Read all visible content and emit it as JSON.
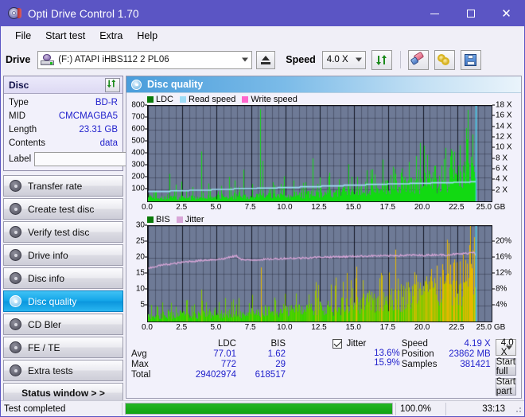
{
  "window": {
    "title": "Opti Drive Control 1.70",
    "app_icon": "disc-icon",
    "minimize": "–",
    "maximize": "□",
    "close": "✕"
  },
  "menu": [
    "File",
    "Start test",
    "Extra",
    "Help"
  ],
  "toolbar": {
    "drive_label": "Drive",
    "drive_value": "(F:)  ATAPI iHBS112  2 PL06",
    "eject_icon": "eject-icon",
    "speed_label": "Speed",
    "speed_value": "4.0 X",
    "refresh_icon": "refresh-icon",
    "eraser_icon": "eraser-icon",
    "bitsetting_icon": "bitsetting-icon",
    "save_icon": "save-icon"
  },
  "sidebar": {
    "disc_panel": {
      "title": "Disc",
      "refresh_icon": "refresh-icon",
      "rows": [
        {
          "key": "Type",
          "value": "BD-R"
        },
        {
          "key": "MID",
          "value": "CMCMAGBA5"
        },
        {
          "key": "Length",
          "value": "23.31 GB"
        },
        {
          "key": "Contents",
          "value": "data"
        }
      ],
      "label_key": "Label",
      "label_value": "",
      "label_placeholder": "",
      "label_button_icon": "disc-icon"
    },
    "items": [
      {
        "label": "Transfer rate",
        "selected": false
      },
      {
        "label": "Create test disc",
        "selected": false
      },
      {
        "label": "Verify test disc",
        "selected": false
      },
      {
        "label": "Drive info",
        "selected": false
      },
      {
        "label": "Disc info",
        "selected": false
      },
      {
        "label": "Disc quality",
        "selected": true
      },
      {
        "label": "CD Bler",
        "selected": false
      },
      {
        "label": "FE / TE",
        "selected": false
      },
      {
        "label": "Extra tests",
        "selected": false
      }
    ],
    "status_window_button": "Status window > >"
  },
  "main": {
    "header_title": "Disc quality",
    "header_icon": "disc-icon"
  },
  "stats": {
    "col_headers": [
      "LDC",
      "BIS"
    ],
    "row_labels": [
      "Avg",
      "Max",
      "Total"
    ],
    "ldc": {
      "avg": "77.01",
      "max": "772",
      "total": "29402974"
    },
    "bis": {
      "avg": "1.62",
      "max": "29",
      "total": "618517"
    },
    "jitter": {
      "label": "Jitter",
      "checked": true,
      "avg": "13.6%",
      "max": "15.9%"
    },
    "speed_label": "Speed",
    "speed_value": "4.19 X",
    "position_label": "Position",
    "position_value": "23862 MB",
    "samples_label": "Samples",
    "samples_value": "381421",
    "speed_select": "4.0 X",
    "start_full_button": "Start full",
    "start_part_button": "Start part"
  },
  "statusbar": {
    "message": "Test completed",
    "percent_text": "100.0%",
    "percent_value": 100,
    "elapsed": "33:13"
  },
  "colors": {
    "titlebar": "#5b55c4",
    "ldc_green": "#12d912",
    "read_speed": "#9fdcf5",
    "write_speed": "#ff66cc",
    "jitter_pink": "#d8a6d8",
    "plot_bg": "#6e7a96",
    "accent_selected": "#13a5e8",
    "value_blue": "#2222cc",
    "progress_green": "#12a312"
  },
  "chart_data": [
    {
      "id": "ldc-chart",
      "type": "area",
      "title": "",
      "xlabel": "GB",
      "ylabel": "",
      "xlim": [
        0,
        25
      ],
      "ylim": [
        0,
        800
      ],
      "xticks": [
        "0.0",
        "2.5",
        "5.0",
        "7.5",
        "10.0",
        "12.5",
        "15.0",
        "17.5",
        "20.0",
        "22.5",
        "25.0"
      ],
      "xtick_values": [
        0,
        2.5,
        5,
        7.5,
        10,
        12.5,
        15,
        17.5,
        20,
        22.5,
        25
      ],
      "x_unit_label": "GB",
      "yticks": [
        100,
        200,
        300,
        400,
        500,
        600,
        700,
        800
      ],
      "y2label": "Speed",
      "y2lim": [
        0,
        18
      ],
      "y2ticks": [
        "2 X",
        "4 X",
        "6 X",
        "8 X",
        "10 X",
        "12 X",
        "14 X",
        "16 X",
        "18 X"
      ],
      "y2tick_values": [
        2,
        4,
        6,
        8,
        10,
        12,
        14,
        16,
        18
      ],
      "grid": true,
      "legend": [
        {
          "name": "LDC",
          "color": "#0a7a0a"
        },
        {
          "name": "Read speed",
          "color": "#9fdcf5"
        },
        {
          "name": "Write speed",
          "color": "#ff66cc"
        }
      ],
      "legend_position": "top-left",
      "data_extent_x": [
        0,
        23.86
      ],
      "series": [
        {
          "name": "LDC",
          "kind": "impulse-area",
          "color": "#12d912",
          "baseline_profile": [
            {
              "x": 0.0,
              "y": 28
            },
            {
              "x": 1.0,
              "y": 30
            },
            {
              "x": 2.0,
              "y": 32
            },
            {
              "x": 3.0,
              "y": 34
            },
            {
              "x": 4.0,
              "y": 36
            },
            {
              "x": 5.0,
              "y": 38
            },
            {
              "x": 6.0,
              "y": 40
            },
            {
              "x": 7.0,
              "y": 42
            },
            {
              "x": 8.0,
              "y": 45
            },
            {
              "x": 9.0,
              "y": 48
            },
            {
              "x": 10.0,
              "y": 52
            },
            {
              "x": 11.0,
              "y": 58
            },
            {
              "x": 12.0,
              "y": 64
            },
            {
              "x": 13.0,
              "y": 72
            },
            {
              "x": 14.0,
              "y": 82
            },
            {
              "x": 15.0,
              "y": 92
            },
            {
              "x": 16.0,
              "y": 104
            },
            {
              "x": 17.0,
              "y": 118
            },
            {
              "x": 18.0,
              "y": 134
            },
            {
              "x": 19.0,
              "y": 150
            },
            {
              "x": 20.0,
              "y": 168
            },
            {
              "x": 21.0,
              "y": 186
            },
            {
              "x": 22.0,
              "y": 210
            },
            {
              "x": 23.0,
              "y": 240
            },
            {
              "x": 23.5,
              "y": 270
            },
            {
              "x": 23.86,
              "y": 300
            }
          ],
          "spikes": [
            {
              "x": 1.55,
              "y": 230
            },
            {
              "x": 2.05,
              "y": 140
            },
            {
              "x": 2.45,
              "y": 165
            },
            {
              "x": 3.25,
              "y": 120
            },
            {
              "x": 3.9,
              "y": 418
            },
            {
              "x": 4.4,
              "y": 150
            },
            {
              "x": 5.3,
              "y": 130
            },
            {
              "x": 5.9,
              "y": 205
            },
            {
              "x": 6.3,
              "y": 175
            },
            {
              "x": 6.95,
              "y": 265
            },
            {
              "x": 7.6,
              "y": 145
            },
            {
              "x": 8.15,
              "y": 772
            },
            {
              "x": 8.35,
              "y": 340
            },
            {
              "x": 9.1,
              "y": 160
            },
            {
              "x": 9.9,
              "y": 210
            },
            {
              "x": 10.6,
              "y": 175
            },
            {
              "x": 11.3,
              "y": 155
            },
            {
              "x": 12.0,
              "y": 360
            },
            {
              "x": 12.5,
              "y": 200
            },
            {
              "x": 13.2,
              "y": 240
            },
            {
              "x": 13.9,
              "y": 185
            },
            {
              "x": 14.6,
              "y": 310
            },
            {
              "x": 15.2,
              "y": 205
            },
            {
              "x": 15.9,
              "y": 260
            },
            {
              "x": 16.5,
              "y": 225
            },
            {
              "x": 17.1,
              "y": 350
            },
            {
              "x": 17.8,
              "y": 290
            },
            {
              "x": 18.4,
              "y": 240
            },
            {
              "x": 19.0,
              "y": 330
            },
            {
              "x": 19.7,
              "y": 265
            },
            {
              "x": 20.3,
              "y": 390
            },
            {
              "x": 20.9,
              "y": 300
            },
            {
              "x": 21.5,
              "y": 355
            },
            {
              "x": 22.1,
              "y": 420
            },
            {
              "x": 22.7,
              "y": 470
            },
            {
              "x": 23.2,
              "y": 520
            },
            {
              "x": 23.6,
              "y": 560
            }
          ]
        },
        {
          "name": "Read speed",
          "kind": "step-line",
          "color": "#9fdcf5",
          "axis": "right",
          "points": [
            {
              "x": 0.0,
              "y": 1.85
            },
            {
              "x": 1.6,
              "y": 2.0
            },
            {
              "x": 3.0,
              "y": 2.1
            },
            {
              "x": 4.6,
              "y": 2.25
            },
            {
              "x": 6.2,
              "y": 2.4
            },
            {
              "x": 7.9,
              "y": 2.5
            },
            {
              "x": 9.4,
              "y": 2.6
            },
            {
              "x": 11.0,
              "y": 2.75
            },
            {
              "x": 12.6,
              "y": 2.9
            },
            {
              "x": 14.2,
              "y": 3.05
            },
            {
              "x": 15.8,
              "y": 3.2
            },
            {
              "x": 17.4,
              "y": 3.3
            },
            {
              "x": 19.0,
              "y": 3.4
            },
            {
              "x": 20.6,
              "y": 3.5
            },
            {
              "x": 22.2,
              "y": 3.6
            },
            {
              "x": 23.4,
              "y": 3.7
            },
            {
              "x": 23.86,
              "y": 3.75
            }
          ]
        },
        {
          "name": "end-marker",
          "kind": "vline",
          "color": "#45d8f5",
          "x": 23.86
        }
      ]
    },
    {
      "id": "bis-jitter-chart",
      "type": "area",
      "title": "",
      "xlabel": "GB",
      "xlim": [
        0,
        25
      ],
      "ylim": [
        0,
        30
      ],
      "xticks": [
        "0.0",
        "2.5",
        "5.0",
        "7.5",
        "10.0",
        "12.5",
        "15.0",
        "17.5",
        "20.0",
        "22.5",
        "25.0"
      ],
      "xtick_values": [
        0,
        2.5,
        5,
        7.5,
        10,
        12.5,
        15,
        17.5,
        20,
        22.5,
        25
      ],
      "x_unit_label": "GB",
      "yticks": [
        5,
        10,
        15,
        20,
        25,
        30
      ],
      "y2lim": [
        0,
        24
      ],
      "y2ticks": [
        "4%",
        "8%",
        "12%",
        "16%",
        "20%"
      ],
      "y2tick_values": [
        4,
        8,
        12,
        16,
        20
      ],
      "grid": true,
      "legend": [
        {
          "name": "BIS",
          "color": "#0a7a0a"
        },
        {
          "name": "Jitter",
          "color": "#d8a6d8"
        }
      ],
      "legend_position": "top-left",
      "data_extent_x": [
        0,
        23.86
      ],
      "series": [
        {
          "name": "BIS",
          "kind": "impulse-area",
          "color_low": "#12d912",
          "color_high": "#e8b800",
          "baseline_profile": [
            {
              "x": 0.0,
              "y": 2.0
            },
            {
              "x": 1.0,
              "y": 2.1
            },
            {
              "x": 2.0,
              "y": 2.2
            },
            {
              "x": 3.0,
              "y": 2.3
            },
            {
              "x": 4.0,
              "y": 2.4
            },
            {
              "x": 5.0,
              "y": 2.5
            },
            {
              "x": 6.0,
              "y": 2.6
            },
            {
              "x": 7.0,
              "y": 2.8
            },
            {
              "x": 8.0,
              "y": 3.0
            },
            {
              "x": 9.0,
              "y": 3.2
            },
            {
              "x": 10.0,
              "y": 3.5
            },
            {
              "x": 11.0,
              "y": 3.8
            },
            {
              "x": 12.0,
              "y": 4.2
            },
            {
              "x": 13.0,
              "y": 4.6
            },
            {
              "x": 14.0,
              "y": 5.1
            },
            {
              "x": 15.0,
              "y": 5.7
            },
            {
              "x": 16.0,
              "y": 6.4
            },
            {
              "x": 17.0,
              "y": 7.2
            },
            {
              "x": 18.0,
              "y": 8.0
            },
            {
              "x": 19.0,
              "y": 8.8
            },
            {
              "x": 20.0,
              "y": 9.6
            },
            {
              "x": 21.0,
              "y": 10.6
            },
            {
              "x": 22.0,
              "y": 12.0
            },
            {
              "x": 23.0,
              "y": 14.0
            },
            {
              "x": 23.5,
              "y": 16.0
            },
            {
              "x": 23.86,
              "y": 18.0
            }
          ],
          "spikes": [
            {
              "x": 3.85,
              "y": 10.0
            },
            {
              "x": 8.2,
              "y": 17.0
            },
            {
              "x": 12.4,
              "y": 11.5
            },
            {
              "x": 14.2,
              "y": 12.5
            },
            {
              "x": 15.6,
              "y": 13.0
            },
            {
              "x": 17.0,
              "y": 14.5
            },
            {
              "x": 18.2,
              "y": 13.5
            },
            {
              "x": 19.4,
              "y": 15.5
            },
            {
              "x": 20.6,
              "y": 16.5
            },
            {
              "x": 21.4,
              "y": 18.0
            },
            {
              "x": 22.3,
              "y": 19.5
            },
            {
              "x": 22.9,
              "y": 21.0
            },
            {
              "x": 23.4,
              "y": 24.0
            },
            {
              "x": 23.7,
              "y": 26.5
            }
          ]
        },
        {
          "name": "Jitter",
          "kind": "line",
          "color": "#d8a6d8",
          "axis": "right",
          "points": [
            {
              "x": 0.0,
              "y": 13.3
            },
            {
              "x": 0.5,
              "y": 13.8
            },
            {
              "x": 1.0,
              "y": 14.2
            },
            {
              "x": 1.5,
              "y": 14.4
            },
            {
              "x": 2.0,
              "y": 14.6
            },
            {
              "x": 2.5,
              "y": 14.9
            },
            {
              "x": 3.0,
              "y": 15.1
            },
            {
              "x": 3.5,
              "y": 15.2
            },
            {
              "x": 4.0,
              "y": 15.4
            },
            {
              "x": 4.5,
              "y": 15.5
            },
            {
              "x": 5.0,
              "y": 15.6
            },
            {
              "x": 5.5,
              "y": 15.8
            },
            {
              "x": 6.0,
              "y": 16.2
            },
            {
              "x": 6.4,
              "y": 16.5
            },
            {
              "x": 6.8,
              "y": 15.6
            },
            {
              "x": 7.2,
              "y": 15.4
            },
            {
              "x": 7.8,
              "y": 15.5
            },
            {
              "x": 8.4,
              "y": 15.6
            },
            {
              "x": 9.0,
              "y": 15.7
            },
            {
              "x": 9.6,
              "y": 15.8
            },
            {
              "x": 10.2,
              "y": 15.9
            },
            {
              "x": 10.8,
              "y": 15.9
            },
            {
              "x": 11.4,
              "y": 16.0
            },
            {
              "x": 12.0,
              "y": 16.1
            },
            {
              "x": 12.6,
              "y": 16.2
            },
            {
              "x": 13.2,
              "y": 16.2
            },
            {
              "x": 13.8,
              "y": 16.3
            },
            {
              "x": 14.4,
              "y": 16.3
            },
            {
              "x": 15.0,
              "y": 16.4
            },
            {
              "x": 15.6,
              "y": 16.4
            },
            {
              "x": 16.2,
              "y": 16.5
            },
            {
              "x": 16.8,
              "y": 16.5
            },
            {
              "x": 17.4,
              "y": 16.5
            },
            {
              "x": 18.0,
              "y": 16.6
            },
            {
              "x": 18.6,
              "y": 16.6
            },
            {
              "x": 19.2,
              "y": 16.7
            },
            {
              "x": 19.8,
              "y": 16.6
            },
            {
              "x": 20.4,
              "y": 16.7
            },
            {
              "x": 21.0,
              "y": 16.8
            },
            {
              "x": 21.6,
              "y": 16.7
            },
            {
              "x": 22.2,
              "y": 16.9
            },
            {
              "x": 22.8,
              "y": 17.0
            },
            {
              "x": 23.3,
              "y": 17.2
            },
            {
              "x": 23.7,
              "y": 17.5
            },
            {
              "x": 23.86,
              "y": 16.6
            }
          ]
        },
        {
          "name": "end-marker",
          "kind": "vline",
          "color": "#45d8f5",
          "x": 23.86
        }
      ]
    }
  ]
}
